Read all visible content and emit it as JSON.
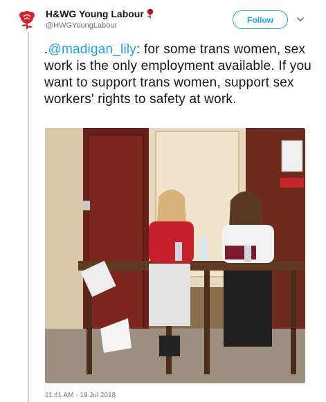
{
  "account": {
    "display_name": "H&WG Young Labour",
    "handle": "@HWGYoungLabour",
    "avatar_icon": "labour-rose-logo",
    "name_emoji_icon": "rose-icon"
  },
  "follow_button": {
    "label": "Follow"
  },
  "menu_icon": "chevron-down-icon",
  "tweet": {
    "prefix": ".",
    "mention": "@madigan_lily",
    "text_after_mention": ": for some trans women, sex work is the only employment available. If you want to support trans women, support sex workers' rights to safety at work."
  },
  "photo": {
    "description_icon": "attached-photo"
  },
  "timestamp": "11:41 AM - 19 Jul 2018",
  "colors": {
    "accent": "#1da1f2",
    "text": "#14171a",
    "muted": "#657786",
    "brand_red": "#d6202c"
  }
}
